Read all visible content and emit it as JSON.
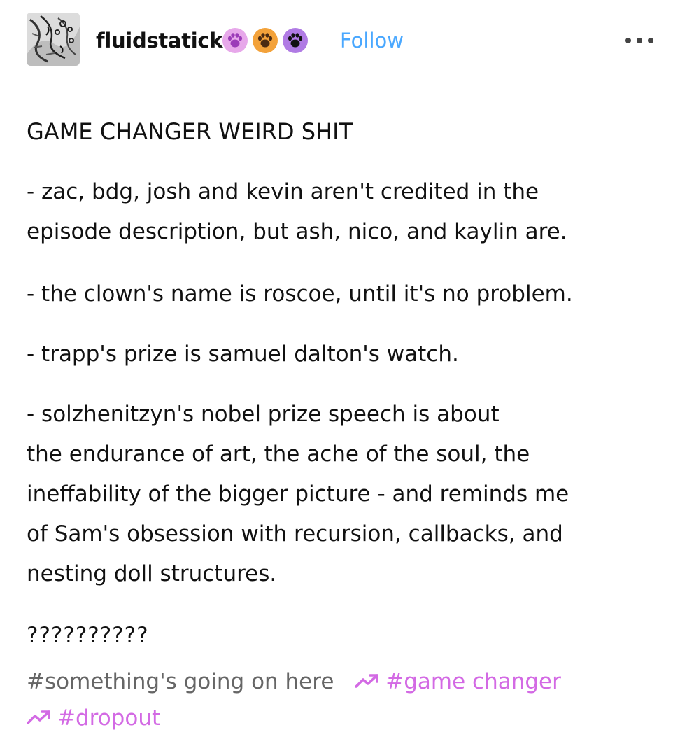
{
  "header": {
    "username": "fluidstatick",
    "follow_label": "Follow",
    "badges": [
      {
        "icon": "paw-icon",
        "bg": "#e7a8ea",
        "fg": "#9b3bb8"
      },
      {
        "icon": "paw-icon",
        "bg": "#f3a23a",
        "fg": "#4a2a12"
      },
      {
        "icon": "paw-icon",
        "bg": "#b07be4",
        "fg": "#111111"
      }
    ]
  },
  "post": {
    "title": "GAME CHANGER WEIRD SHIT",
    "p1": [
      "- zac, bdg, josh and kevin aren't credited in the",
      "episode description, but ash, nico, and kaylin are."
    ],
    "p2": "- the clown's name is roscoe, until it's no problem.",
    "p3": "- trapp's prize is samuel dalton's watch.",
    "p4": [
      "- solzhenitzyn's nobel prize speech is about",
      "the endurance of art, the ache of the soul, the",
      "ineffability of the bigger picture - and reminds me",
      "of Sam's obsession with recursion, callbacks, and",
      "nesting doll structures."
    ],
    "p5": "??????????"
  },
  "tags": {
    "plain": "#something's going on here",
    "trending": [
      "#game changer",
      "#dropout"
    ],
    "trend_color": "#d36ae4",
    "plain_color": "#666666"
  },
  "colors": {
    "follow": "#4aa8ff",
    "text": "#111111"
  }
}
